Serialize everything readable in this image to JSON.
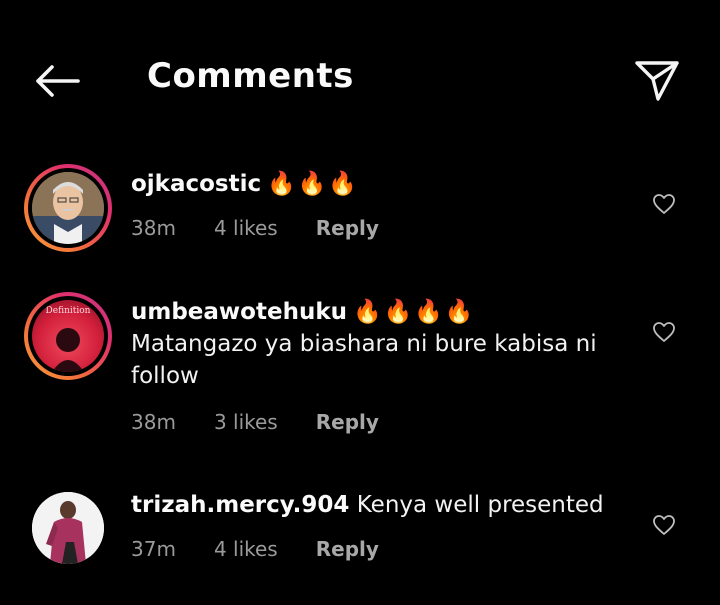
{
  "header": {
    "title": "Comments",
    "back_icon": "arrow-left-icon",
    "share_icon": "paper-plane-icon"
  },
  "comments": [
    {
      "username": "ojkacostic",
      "text": "",
      "emoji": "🔥🔥🔥",
      "time": "38m",
      "likes": "4 likes",
      "reply": "Reply",
      "has_story_ring": true
    },
    {
      "username": "umbeawotehuku",
      "emoji": "🔥🔥🔥🔥",
      "text": "Matangazo ya biashara ni bure kabisa ni follow",
      "avatar_caption": "Definition",
      "time": "38m",
      "likes": "3 likes",
      "reply": "Reply",
      "has_story_ring": true
    },
    {
      "username": "trizah.mercy.904",
      "text": "Kenya well presented",
      "time": "37m",
      "likes": "4 likes",
      "reply": "Reply",
      "has_story_ring": false
    }
  ],
  "colors": {
    "background": "#000000",
    "text": "#f2f2f2",
    "meta": "#9a9a9a"
  }
}
